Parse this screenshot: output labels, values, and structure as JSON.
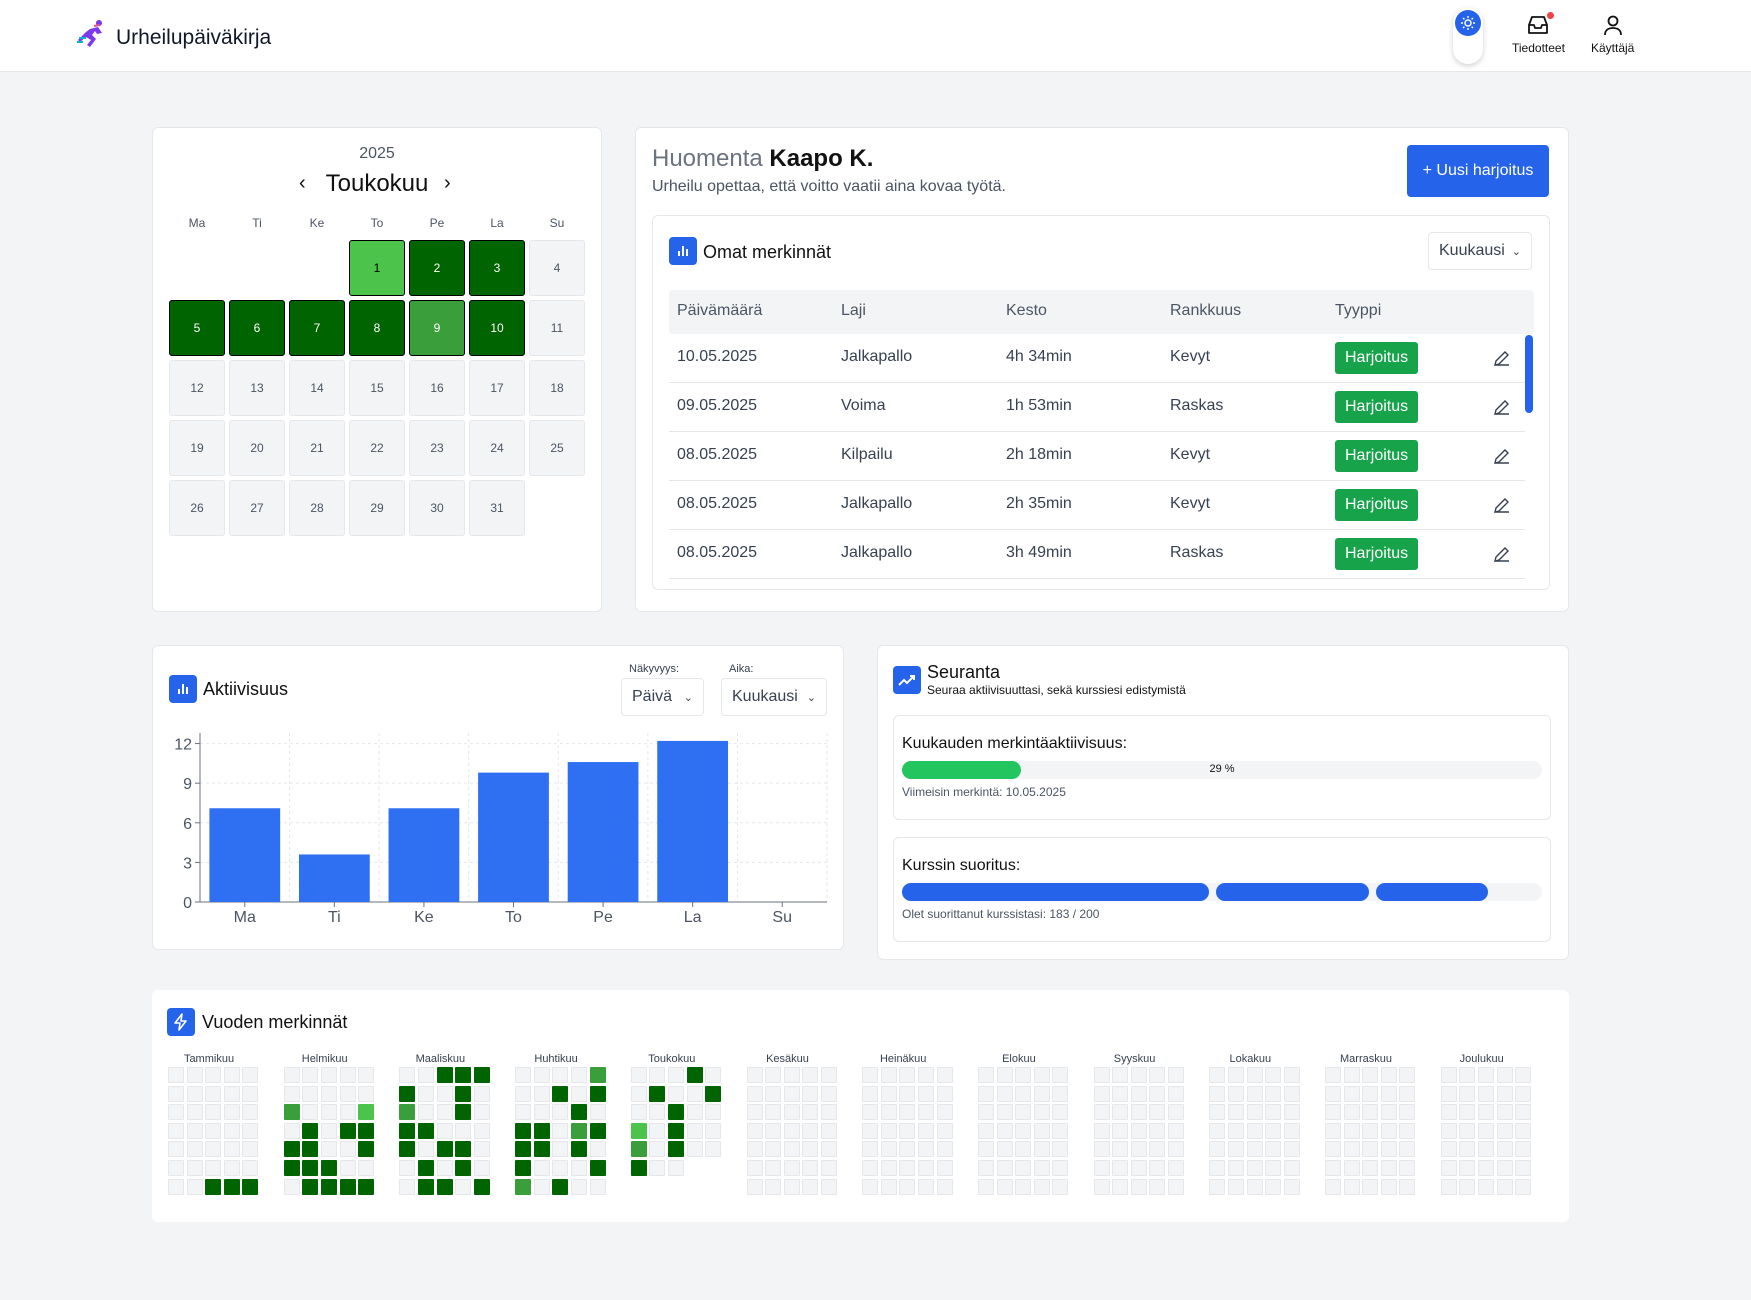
{
  "app": {
    "title": "Urheilupäiväkirja"
  },
  "nav": {
    "notifications": "Tiedotteet",
    "user": "Käyttäjä",
    "theme_icon": "sun-icon"
  },
  "colors": {
    "accent": "#2563eb",
    "level_high": "#006400",
    "level_mid": "#3a9e3a",
    "level_low": "#4cc44c",
    "empty": "#f3f4f6",
    "badge": "#16a34a"
  },
  "calendar": {
    "year": "2025",
    "month": "Toukokuu",
    "weekdays": [
      "Ma",
      "Ti",
      "Ke",
      "To",
      "Pe",
      "La",
      "Su"
    ],
    "start_offset": 3,
    "days": [
      {
        "d": "1",
        "level": 1
      },
      {
        "d": "2",
        "level": 3
      },
      {
        "d": "3",
        "level": 3
      },
      {
        "d": "4",
        "level": 0
      },
      {
        "d": "5",
        "level": 3
      },
      {
        "d": "6",
        "level": 3
      },
      {
        "d": "7",
        "level": 3
      },
      {
        "d": "8",
        "level": 3
      },
      {
        "d": "9",
        "level": 2
      },
      {
        "d": "10",
        "level": 3
      },
      {
        "d": "11",
        "level": 0
      },
      {
        "d": "12",
        "level": 0
      },
      {
        "d": "13",
        "level": 0
      },
      {
        "d": "14",
        "level": 0
      },
      {
        "d": "15",
        "level": 0
      },
      {
        "d": "16",
        "level": 0
      },
      {
        "d": "17",
        "level": 0
      },
      {
        "d": "18",
        "level": 0
      },
      {
        "d": "19",
        "level": 0
      },
      {
        "d": "20",
        "level": 0
      },
      {
        "d": "21",
        "level": 0
      },
      {
        "d": "22",
        "level": 0
      },
      {
        "d": "23",
        "level": 0
      },
      {
        "d": "24",
        "level": 0
      },
      {
        "d": "25",
        "level": 0
      },
      {
        "d": "26",
        "level": 0
      },
      {
        "d": "27",
        "level": 0
      },
      {
        "d": "28",
        "level": 0
      },
      {
        "d": "29",
        "level": 0
      },
      {
        "d": "30",
        "level": 0
      },
      {
        "d": "31",
        "level": 0
      }
    ]
  },
  "welcome": {
    "greeting": "Huomenta",
    "name": "Kaapo K.",
    "quote": "Urheilu opettaa, että voitto vaatii aina kovaa työtä.",
    "new_button": "+ Uusi harjoitus"
  },
  "entries": {
    "title": "Omat merkinnät",
    "period": "Kuukausi",
    "columns": [
      "Päivämäärä",
      "Laji",
      "Kesto",
      "Rankkuus",
      "Tyyppi"
    ],
    "rows": [
      [
        "10.05.2025",
        "Jalkapallo",
        "4h 34min",
        "Kevyt",
        "Harjoitus"
      ],
      [
        "09.05.2025",
        "Voima",
        "1h 53min",
        "Raskas",
        "Harjoitus"
      ],
      [
        "08.05.2025",
        "Kilpailu",
        "2h 18min",
        "Kevyt",
        "Harjoitus"
      ],
      [
        "08.05.2025",
        "Jalkapallo",
        "2h 35min",
        "Kevyt",
        "Harjoitus"
      ],
      [
        "08.05.2025",
        "Jalkapallo",
        "3h 49min",
        "Raskas",
        "Harjoitus"
      ]
    ]
  },
  "activity": {
    "title": "Aktiivisuus",
    "visibility_label": "Näkyvyys:",
    "visibility": "Päivä",
    "time_label": "Aika:",
    "time": "Kuukausi"
  },
  "chart_data": {
    "type": "bar",
    "categories": [
      "Ma",
      "Ti",
      "Ke",
      "To",
      "Pe",
      "La",
      "Su"
    ],
    "values": [
      7.1,
      3.6,
      7.1,
      9.8,
      10.6,
      12.2,
      0
    ],
    "yticks": [
      0,
      3,
      6,
      9,
      12
    ],
    "ylim": [
      0,
      12.8
    ],
    "grid": true,
    "color": "#2f6ff2"
  },
  "tracking": {
    "title": "Seuranta",
    "subtitle": "Seuraa aktiivisuuttasi, sekä kurssiesi edistymistä",
    "monthly": {
      "label": "Kuukauden merkintäaktiivisuus:",
      "percent": 29,
      "percent_text": "29 %",
      "last_entry": "Viimeisin merkintä: 10.05.2025"
    },
    "course": {
      "label": "Kurssin suoritus:",
      "completed": 183,
      "total": 200,
      "text": "Olet suorittanut kurssistasi: 183 / 200"
    }
  },
  "year": {
    "title": "Vuoden merkinnät",
    "months": [
      {
        "name": "Tammikuu",
        "cells": "................................3333...3.33.3333.3322..33.....1..3.13..3"
      },
      {
        "name": "Helmikuu",
        "cells": "..........2...1.3.3333..3333...3333.3333.31"
      },
      {
        "name": "Maaliskuu",
        "cells": "..3333..3.2..3.33...3.33..3.3..33.3.33333.3333"
      },
      {
        "name": "Huhtikuu",
        "cells": "....2..3.3...3.33.2333.3.3...32.3..33..3.33...3.3"
      },
      {
        "name": "Toukokuu",
        "cells": "...3..3..3..3..1.3..2.3..3.."
      },
      {
        "name": "Kesäkuu",
        "cells": "........................................................"
      },
      {
        "name": "Heinäkuu",
        "cells": "................................................"
      },
      {
        "name": "Elokuu",
        "cells": "....................................................."
      },
      {
        "name": "Syyskuu",
        "cells": "................................................"
      },
      {
        "name": "Lokakuu",
        "cells": "..................................................."
      },
      {
        "name": "Marraskuu",
        "cells": "..................................................."
      },
      {
        "name": "Joulukuu",
        "cells": "............................................"
      }
    ]
  }
}
